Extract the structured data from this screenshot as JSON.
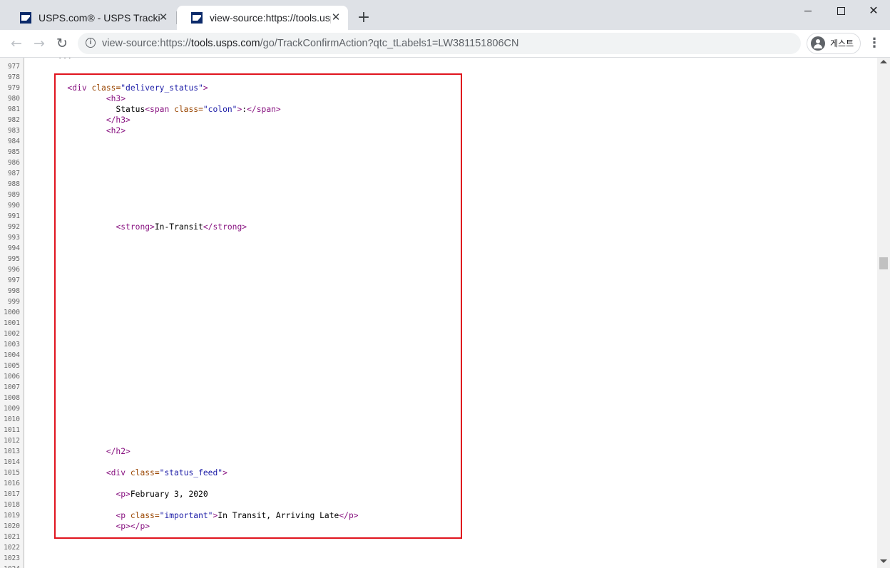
{
  "browser": {
    "tabs": [
      {
        "title": "USPS.com® - USPS Tracking® Results",
        "close": "✕"
      },
      {
        "title": "view-source:https://tools.usps.com",
        "close": "✕"
      }
    ],
    "new_tab": "+",
    "window": {
      "close": "✕"
    },
    "address_bar": {
      "prefix": "view-source:https://",
      "host": "tools.usps.com",
      "path": "/go/TrackConfirmAction?qtc_tLabels1=LW381151806CN"
    },
    "profile": {
      "label": "게스트"
    },
    "nav": {
      "back": "←",
      "forward": "→",
      "reload": "↻",
      "info": "i",
      "menu": "⋮"
    }
  },
  "source": {
    "partial_top": "    ‹ ... ›  ···  ··· ·",
    "lines": [
      {
        "n": "977",
        "text": ""
      },
      {
        "n": "978",
        "text": ""
      },
      {
        "n": "979",
        "indent": "        ",
        "tag_open": "<div ",
        "attr": "class=",
        "val": "\"delivery_status\"",
        "tag_close": ">"
      },
      {
        "n": "980",
        "indent": "                ",
        "tag_open": "<h3>"
      },
      {
        "n": "981",
        "indent": "                  ",
        "text": "Status",
        "tag_open": "<span ",
        "attr": "class=",
        "val": "\"colon\"",
        "tag_close": ">",
        "tail": ":",
        "end_tag": "</span>"
      },
      {
        "n": "982",
        "indent": "                ",
        "tag_open": "</h3>"
      },
      {
        "n": "983",
        "indent": "                ",
        "tag_open": "<h2>"
      },
      {
        "n": "984",
        "text": ""
      },
      {
        "n": "985",
        "text": ""
      },
      {
        "n": "986",
        "text": ""
      },
      {
        "n": "987",
        "text": ""
      },
      {
        "n": "988",
        "text": ""
      },
      {
        "n": "989",
        "text": ""
      },
      {
        "n": "990",
        "text": ""
      },
      {
        "n": "991",
        "text": ""
      },
      {
        "n": "992",
        "indent": "                  ",
        "tag_open": "<strong>",
        "text": "In-Transit",
        "end_tag": "</strong>"
      },
      {
        "n": "993",
        "text": ""
      },
      {
        "n": "994",
        "text": ""
      },
      {
        "n": "995",
        "text": ""
      },
      {
        "n": "996",
        "text": ""
      },
      {
        "n": "997",
        "text": ""
      },
      {
        "n": "998",
        "text": ""
      },
      {
        "n": "999",
        "text": ""
      },
      {
        "n": "1000",
        "text": ""
      },
      {
        "n": "1001",
        "text": ""
      },
      {
        "n": "1002",
        "text": ""
      },
      {
        "n": "1003",
        "text": ""
      },
      {
        "n": "1004",
        "text": ""
      },
      {
        "n": "1005",
        "text": ""
      },
      {
        "n": "1006",
        "text": ""
      },
      {
        "n": "1007",
        "text": ""
      },
      {
        "n": "1008",
        "text": ""
      },
      {
        "n": "1009",
        "text": ""
      },
      {
        "n": "1010",
        "text": ""
      },
      {
        "n": "1011",
        "text": ""
      },
      {
        "n": "1012",
        "text": ""
      },
      {
        "n": "1013",
        "indent": "                ",
        "tag_open": "</h2>"
      },
      {
        "n": "1014",
        "text": ""
      },
      {
        "n": "1015",
        "indent": "                ",
        "tag_open": "<div ",
        "attr": "class=",
        "val": "\"status_feed\"",
        "tag_close": ">"
      },
      {
        "n": "1016",
        "text": ""
      },
      {
        "n": "1017",
        "indent": "                  ",
        "tag_open": "<p>",
        "text": "February 3, 2020"
      },
      {
        "n": "1018",
        "text": ""
      },
      {
        "n": "1019",
        "indent": "                  ",
        "tag_open": "<p ",
        "attr": "class=",
        "val": "\"important\"",
        "tag_close": ">",
        "text": "In Transit, Arriving Late",
        "end_tag": "</p>"
      },
      {
        "n": "1020",
        "indent": "                  ",
        "tag_open": "<p>",
        "end_tag": "</p>"
      },
      {
        "n": "1021",
        "text": ""
      },
      {
        "n": "1022",
        "text": ""
      },
      {
        "n": "1023",
        "text": ""
      },
      {
        "n": "1024",
        "text": ""
      }
    ]
  }
}
